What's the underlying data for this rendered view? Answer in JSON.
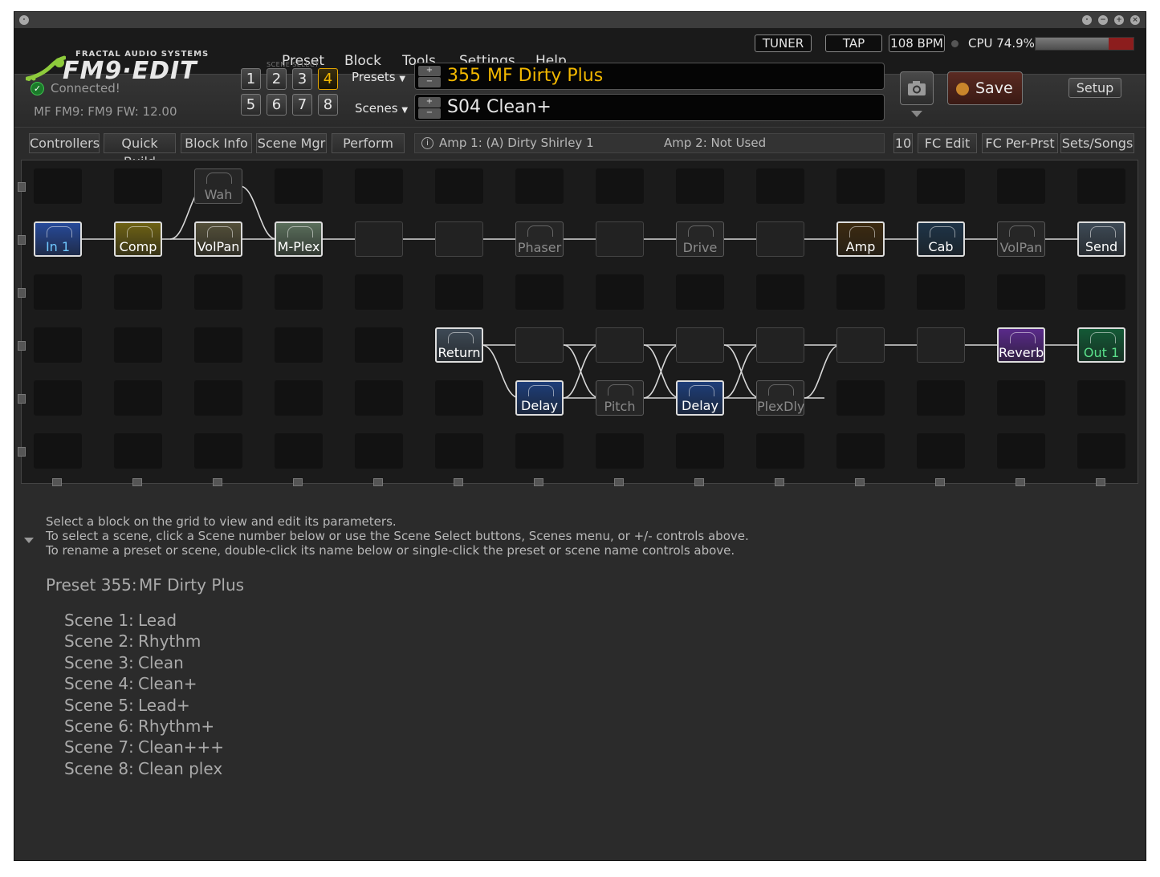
{
  "app": {
    "logo_top": "FRACTAL AUDIO SYSTEMS",
    "logo_main": "FM9·EDIT"
  },
  "menu": [
    "Preset",
    "Block",
    "Tools",
    "Settings",
    "Help"
  ],
  "header": {
    "tuner": "TUNER",
    "tap": "TAP",
    "bpm": "108 BPM",
    "cpu_label": "CPU 74.9%",
    "cpu_percent": 74.9,
    "connected": "Connected!",
    "firmware": "MF FM9: FM9 FW: 12.00",
    "scene_select_label": "SCENE SELECT",
    "scene_buttons": [
      "1",
      "2",
      "3",
      "4",
      "5",
      "6",
      "7",
      "8"
    ],
    "active_scene": "4",
    "presets_label": "Presets",
    "scenes_label": "Scenes",
    "preset_number": "355",
    "preset_name": "MF Dirty Plus",
    "scene_number": "S04",
    "scene_name": "Clean+",
    "plus": "+",
    "minus": "−",
    "save": "Save",
    "setup": "Setup"
  },
  "toolbar": {
    "tabs_left": [
      "Controllers",
      "Quick Build",
      "Block Info",
      "Scene Mgr",
      "Perform"
    ],
    "info_icon": "i",
    "amp1": "Amp 1: (A) Dirty Shirley 1",
    "amp2": "Amp 2: Not Used",
    "tabs_right": [
      "10",
      "FC Edit",
      "FC Per-Prst",
      "Sets/Songs"
    ]
  },
  "grid": {
    "blocks": [
      {
        "label": "Wah",
        "col": 2,
        "row": 0,
        "ghost": true,
        "color": "#262626"
      },
      {
        "label": "In 1",
        "col": 0,
        "row": 1,
        "color": "#274a9a",
        "text_color": "#6fc8ff"
      },
      {
        "label": "Comp",
        "col": 1,
        "row": 1,
        "color": "#6e6214"
      },
      {
        "label": "VolPan",
        "col": 2,
        "row": 1,
        "color": "#54503a"
      },
      {
        "label": "M-Plex",
        "col": 3,
        "row": 1,
        "color": "#5b6f5c"
      },
      {
        "label": "Phaser",
        "col": 6,
        "row": 1,
        "ghost": true
      },
      {
        "label": "Drive",
        "col": 8,
        "row": 1,
        "ghost": true
      },
      {
        "label": "Amp",
        "col": 10,
        "row": 1,
        "color": "#3c2a10"
      },
      {
        "label": "Cab",
        "col": 11,
        "row": 1,
        "color": "#1e3448"
      },
      {
        "label": "VolPan",
        "col": 12,
        "row": 1,
        "ghost": true
      },
      {
        "label": "Send",
        "col": 13,
        "row": 1,
        "color": "#3e4a56"
      },
      {
        "label": "Return",
        "col": 5,
        "row": 3,
        "color": "#3e4a56"
      },
      {
        "label": "Reverb",
        "col": 12,
        "row": 3,
        "color": "#5a2a8a"
      },
      {
        "label": "Out 1",
        "col": 13,
        "row": 3,
        "color": "#135a36",
        "text_color": "#5ae08a"
      },
      {
        "label": "Delay",
        "col": 6,
        "row": 4,
        "color": "#1e3e7a"
      },
      {
        "label": "Pitch",
        "col": 7,
        "row": 4,
        "ghost": true
      },
      {
        "label": "Delay",
        "col": 8,
        "row": 4,
        "color": "#1e3e7a"
      },
      {
        "label": "PlexDly",
        "col": 9,
        "row": 4,
        "ghost": true
      }
    ]
  },
  "help": {
    "lines": [
      "Select a block on the grid to view and edit its parameters.",
      "To select a scene, click a Scene number below or use the Scene Select buttons, Scenes menu, or +/- controls above.",
      "To rename a preset or scene, double-click its name below or single-click the preset or scene name controls above."
    ],
    "preset_label": "Preset 355:",
    "preset_name": "MF Dirty Plus",
    "scenes": [
      {
        "label": "Scene 1:",
        "name": "Lead"
      },
      {
        "label": "Scene 2:",
        "name": "Rhythm"
      },
      {
        "label": "Scene 3:",
        "name": "Clean"
      },
      {
        "label": "Scene 4:",
        "name": "Clean+"
      },
      {
        "label": "Scene 5:",
        "name": "Lead+"
      },
      {
        "label": "Scene 6:",
        "name": "Rhythm+"
      },
      {
        "label": "Scene 7:",
        "name": "Clean+++"
      },
      {
        "label": "Scene 8:",
        "name": "Clean plex"
      }
    ]
  },
  "colors": {
    "accent": "#f3b800",
    "cpu_bar": "#8c1d1d"
  }
}
